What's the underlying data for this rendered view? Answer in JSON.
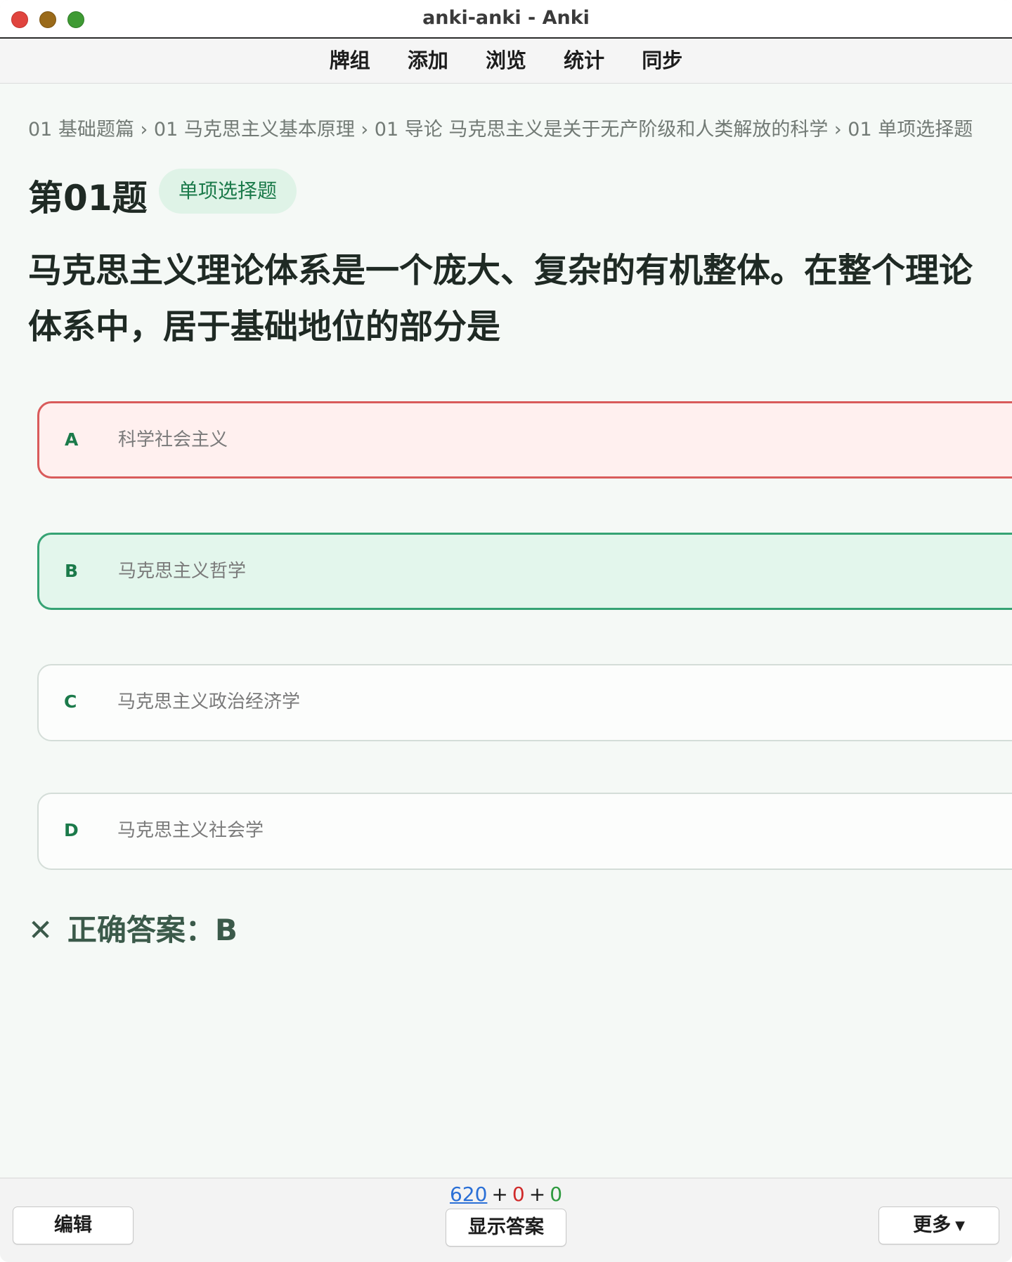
{
  "window": {
    "title": "anki-anki - Anki"
  },
  "menu": {
    "items": [
      "牌组",
      "添加",
      "浏览",
      "统计",
      "同步"
    ]
  },
  "breadcrumb": "01 基础题篇 › 01 马克思主义基本原理 › 01 导论 马克思主义是关于无产阶级和人类解放的科学 › 01 单项选择题",
  "question": {
    "number": "第01题",
    "type_tag": "单项选择题",
    "stem": "马克思主义理论体系是一个庞大、复杂的有机整体。在整个理论体系中，居于基础地位的部分是",
    "options": [
      {
        "letter": "A",
        "text": "科学社会主义",
        "state": "wrong"
      },
      {
        "letter": "B",
        "text": "马克思主义哲学",
        "state": "correct"
      },
      {
        "letter": "C",
        "text": "马克思主义政治经济学",
        "state": "neutral"
      },
      {
        "letter": "D",
        "text": "马克思主义社会学",
        "state": "neutral"
      }
    ],
    "result_icon": "✕",
    "answer_text": "正确答案：B"
  },
  "bottom": {
    "edit_label": "编辑",
    "show_answer_label": "显示答案",
    "more_label": "更多",
    "counts": {
      "new": "620",
      "learn": "0",
      "review": "0",
      "plus": "+"
    }
  },
  "colors": {
    "accent_green": "#1b7a4a",
    "wrong_border": "#d95b5b",
    "correct_border": "#36a374"
  }
}
